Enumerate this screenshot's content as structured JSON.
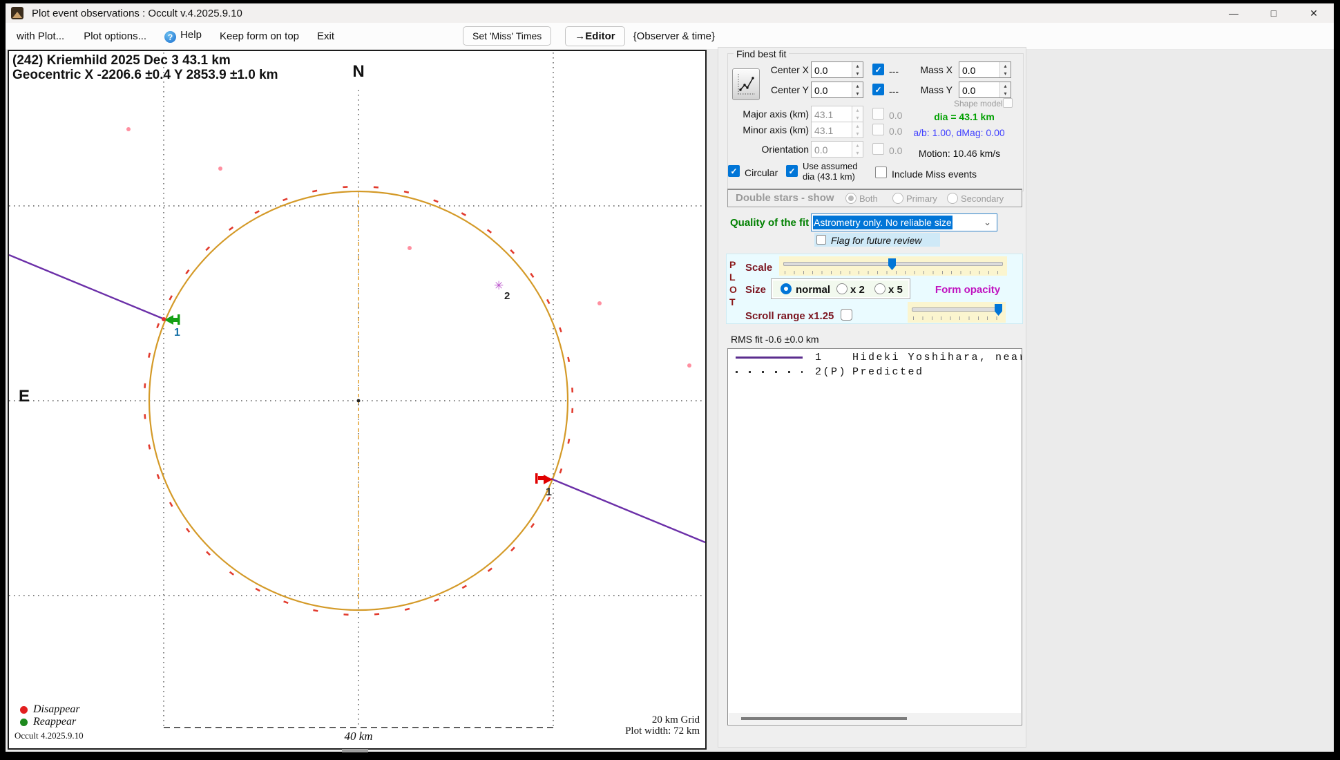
{
  "window": {
    "title": "Plot event observations : Occult v.4.2025.9.10",
    "minimize_glyph": "—",
    "maximize_glyph": "□",
    "close_glyph": "✕"
  },
  "menu": {
    "with_plot": "with Plot...",
    "plot_options": "Plot options...",
    "help": "Help",
    "help_glyph": "?",
    "keep_on_top": "Keep form on top",
    "exit": "Exit",
    "set_miss_times": "Set 'Miss' Times",
    "editor": "→Editor",
    "observer_time": "{Observer & time}"
  },
  "plot": {
    "header_line1": "(242) Kriemhild  2025 Dec 3   43.1 km",
    "header_line2": "Geocentric  X  -2206.6 ±0.4  Y 2853.9 ±1.0 km",
    "north": "N",
    "east": "E",
    "legend_disappear": "Disappear",
    "legend_reappear": "Reappear",
    "version": "Occult 4.2025.9.10",
    "scale_bar_label": "40 km",
    "grid_note": "20 km Grid",
    "width_note": "Plot width: 72 km",
    "chord_reappear_label": "1",
    "chord_disappear_label": "1",
    "predicted_glyph": "✳",
    "predicted_label": "2",
    "readings": {
      "diameter_km": 43.1,
      "grid_spacing_km": 20,
      "plot_width_km": 72,
      "scale_bar_km": 40
    }
  },
  "fit": {
    "group_title": "Find best fit",
    "center_x_label": "Center X",
    "center_x_value": "0.0",
    "center_x_aux": "---",
    "center_y_label": "Center Y",
    "center_y_value": "0.0",
    "center_y_aux": "---",
    "mass_x_label": "Mass X",
    "mass_x_value": "0.0",
    "mass_y_label": "Mass Y",
    "mass_y_value": "0.0",
    "shape_model_label": "Shape model",
    "major_axis_label": "Major axis (km)",
    "major_axis_value": "43.1",
    "major_axis_aux": "0.0",
    "minor_axis_label": "Minor axis (km)",
    "minor_axis_value": "43.1",
    "minor_axis_aux": "0.0",
    "orientation_label": "Orientation",
    "orientation_value": "0.0",
    "orientation_aux": "0.0",
    "dia_text": "dia = 43.1 km",
    "ab_text": "a/b: 1.00, dMag: 0.00",
    "motion_text": "Motion: 10.46 km/s",
    "circular_label": "Circular",
    "use_assumed_line1": "Use assumed",
    "use_assumed_line2": "dia (43.1 km)",
    "include_miss_label": "Include Miss events",
    "double_stars_label": "Double stars - show",
    "double_stars_options": [
      "Both",
      "Primary",
      "Secondary"
    ],
    "quality_label": "Quality of the fit",
    "quality_value": "Astrometry only. No reliable size",
    "flag_label": "Flag for future review"
  },
  "plot_controls": {
    "panel_letters": [
      "P",
      "L",
      "O",
      "T"
    ],
    "scale_label": "Scale",
    "scale_value_percent": 49,
    "size_label": "Size",
    "size_options": [
      "normal",
      "x 2",
      "x 5"
    ],
    "size_selected": "normal",
    "form_opacity_label": "Form opacity",
    "form_opacity_percent": 97,
    "scroll_range_label": "Scroll range x1.25"
  },
  "results": {
    "rms_text": "RMS fit -0.6 ±0.0 km",
    "observations": [
      {
        "id": "1",
        "name": "Hideki Yoshihara, near",
        "line_style": "solid-purple"
      },
      {
        "id": "2(P)",
        "name": "Predicted",
        "line_style": "dotted-black"
      }
    ]
  },
  "colors": {
    "accent": "#0075d7",
    "limb_circle": "#d49a28",
    "chord": "#6b2fa8",
    "disappear": "#e21f1f",
    "reappear": "#1e8a1e",
    "predicted_star": "#bb55cc",
    "quality_text": "#008000",
    "dia_text": "#00a000",
    "ab_text": "#4040ff"
  }
}
